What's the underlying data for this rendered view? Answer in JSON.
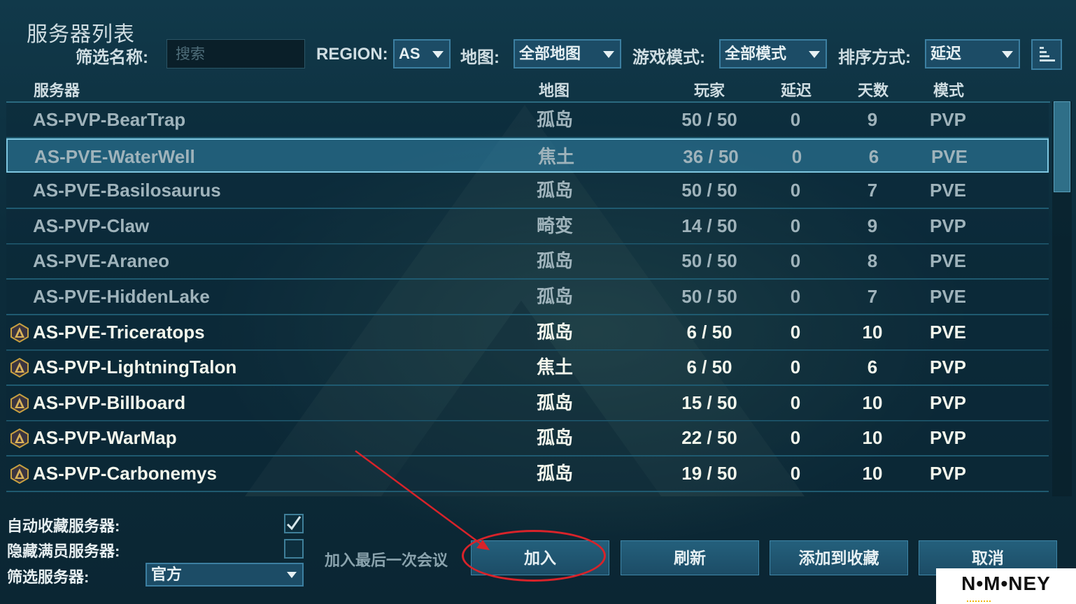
{
  "window": {
    "title": "服务器列表"
  },
  "filters": {
    "name_label": "筛选名称:",
    "search_placeholder": "搜索",
    "region_label": "REGION:",
    "region_value": "AS",
    "map_label": "地图:",
    "map_value": "全部地图",
    "mode_label": "游戏模式:",
    "mode_value": "全部模式",
    "sort_label": "排序方式:",
    "sort_value": "延迟"
  },
  "table": {
    "columns": [
      "服务器",
      "地图",
      "玩家",
      "延迟",
      "天数",
      "模式"
    ],
    "rows": [
      {
        "name": "AS-PVP-BearTrap",
        "map": "孤岛",
        "players": "50 / 50",
        "ping": "0",
        "days": "9",
        "mode": "PVP",
        "official": false,
        "selected": false
      },
      {
        "name": "AS-PVE-WaterWell",
        "map": "焦土",
        "players": "36 / 50",
        "ping": "0",
        "days": "6",
        "mode": "PVE",
        "official": false,
        "selected": true
      },
      {
        "name": "AS-PVE-Basilosaurus",
        "map": "孤岛",
        "players": "50 / 50",
        "ping": "0",
        "days": "7",
        "mode": "PVE",
        "official": false,
        "selected": false
      },
      {
        "name": "AS-PVP-Claw",
        "map": "畸变",
        "players": "14 / 50",
        "ping": "0",
        "days": "9",
        "mode": "PVP",
        "official": false,
        "selected": false
      },
      {
        "name": "AS-PVE-Araneo",
        "map": "孤岛",
        "players": "50 / 50",
        "ping": "0",
        "days": "8",
        "mode": "PVE",
        "official": false,
        "selected": false
      },
      {
        "name": "AS-PVE-HiddenLake",
        "map": "孤岛",
        "players": "50 / 50",
        "ping": "0",
        "days": "7",
        "mode": "PVE",
        "official": false,
        "selected": false
      },
      {
        "name": "AS-PVE-Triceratops",
        "map": "孤岛",
        "players": "6 / 50",
        "ping": "0",
        "days": "10",
        "mode": "PVE",
        "official": true,
        "selected": false
      },
      {
        "name": "AS-PVP-LightningTalon",
        "map": "焦土",
        "players": "6 / 50",
        "ping": "0",
        "days": "6",
        "mode": "PVP",
        "official": true,
        "selected": false
      },
      {
        "name": "AS-PVP-Billboard",
        "map": "孤岛",
        "players": "15 / 50",
        "ping": "0",
        "days": "10",
        "mode": "PVP",
        "official": true,
        "selected": false
      },
      {
        "name": "AS-PVP-WarMap",
        "map": "孤岛",
        "players": "22 / 50",
        "ping": "0",
        "days": "10",
        "mode": "PVP",
        "official": true,
        "selected": false
      },
      {
        "name": "AS-PVP-Carbonemys",
        "map": "孤岛",
        "players": "19 / 50",
        "ping": "0",
        "days": "10",
        "mode": "PVP",
        "official": true,
        "selected": false
      }
    ]
  },
  "options": {
    "auto_favorite_label": "自动收藏服务器:",
    "auto_favorite_checked": true,
    "hide_full_label": "隐藏满员服务器:",
    "hide_full_checked": false,
    "filter_servers_label": "筛选服务器:",
    "filter_servers_value": "官方"
  },
  "buttons": {
    "join_last_session": "加入最后一次会议",
    "join": "加入",
    "refresh": "刷新",
    "add_favorite": "添加到收藏",
    "cancel": "取消"
  },
  "watermark": {
    "text": "N•M•NEY"
  },
  "colors": {
    "annotation": "#d8232a",
    "official_badge": "#c8a040",
    "accent": "#3c7fa1"
  }
}
